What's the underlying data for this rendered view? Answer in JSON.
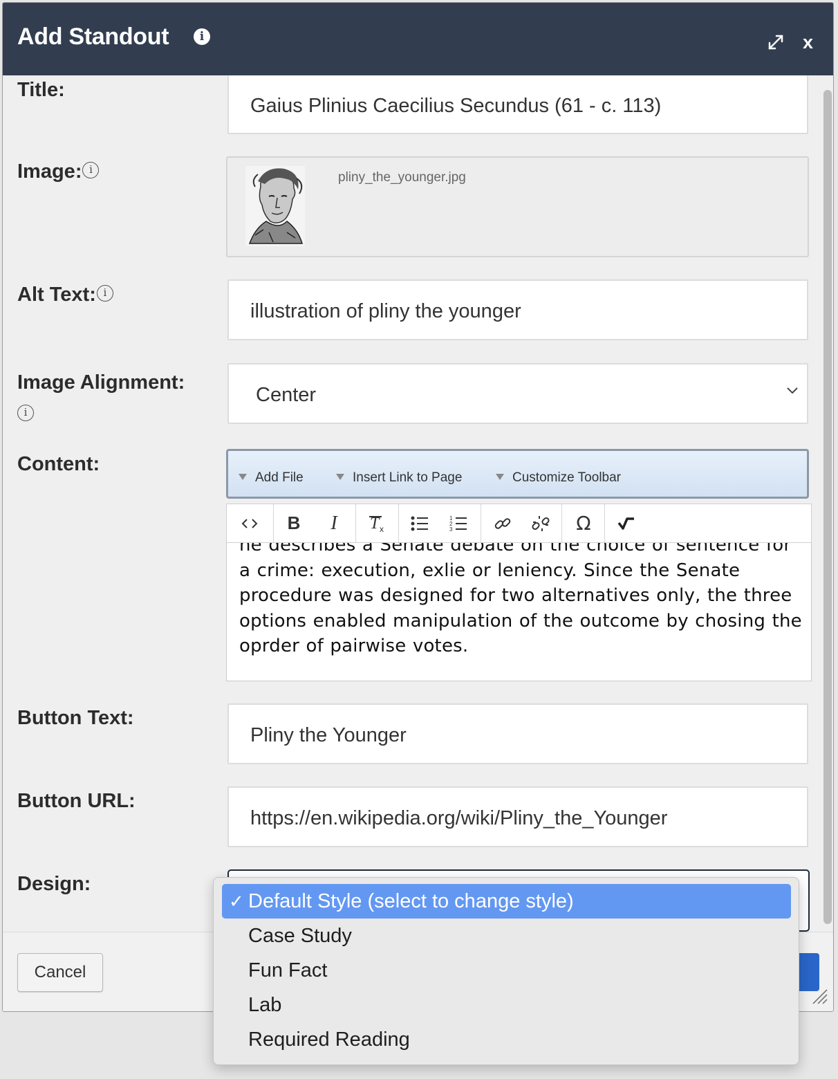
{
  "dialog": {
    "title": "Add Standout",
    "close_label": "x"
  },
  "form": {
    "title_label": "Title:",
    "title_value": "Gaius Plinius Caecilius Secundus (61 - c. 113)",
    "image_label": "Image:",
    "image_filename": "pliny_the_younger.jpg",
    "alt_label": "Alt Text:",
    "alt_value": "illustration of pliny the younger",
    "alignment_label": "Image Alignment:",
    "alignment_value": "Center",
    "content_label": "Content:",
    "button_text_label": "Button Text:",
    "button_text_value": "Pliny the Younger",
    "button_url_label": "Button URL:",
    "button_url_value": "https://en.wikipedia.org/wiki/Pliny_the_Younger",
    "design_label": "Design:"
  },
  "editor": {
    "menu": [
      "Add File",
      "Insert Link to Page",
      "Customize Toolbar"
    ],
    "toolbar_icons": [
      "source-code-icon",
      "bold-icon",
      "italic-icon",
      "remove-format-icon",
      "bulleted-list-icon",
      "numbered-list-icon",
      "link-icon",
      "unlink-icon",
      "special-character-icon",
      "math-icon"
    ],
    "body": "he describes a Senate debate on the choice of sentence for a crime: execution, exlie or leniency. Since the Senate procedure was designed for two alternatives only, the three options enabled manipulation of the outcome by chosing the oprder of pairwise votes."
  },
  "design_dropdown": {
    "selected": "Default Style (select to change style)",
    "options": [
      "Default Style (select to change style)",
      "Case Study",
      "Fun Fact",
      "Lab",
      "Required Reading"
    ]
  },
  "footer": {
    "cancel_label": "Cancel"
  },
  "colors": {
    "titlebar": "#323e50",
    "selected_option": "#6398f2",
    "primary_button": "#2a66c9"
  }
}
